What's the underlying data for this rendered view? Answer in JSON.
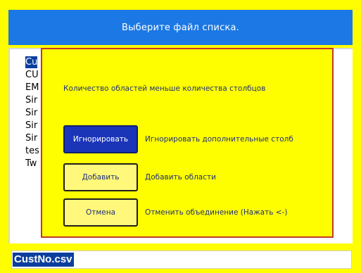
{
  "header": {
    "title": "Выберите файл списка."
  },
  "file_list": {
    "items": [
      "Cu",
      "CU",
      "EM",
      "Sir",
      "Sir",
      "Sir",
      "Sir",
      "tes",
      "Tw"
    ]
  },
  "dialog": {
    "message": "Количество областей меньше количества столбцов",
    "buttons": [
      {
        "label": "Игнорировать",
        "description": "Игнорировать дополнительные столб"
      },
      {
        "label": "Добавить",
        "description": "Добавить области"
      },
      {
        "label": "Отмена",
        "description": "Отменить объединение (Нажать <-)"
      }
    ]
  },
  "filename_field": {
    "value": "CustNo.csv"
  },
  "colors": {
    "background": "#fffe00",
    "header": "#1b78e4",
    "selection": "#0b3f9e",
    "dialog_border": "#c0392b"
  }
}
